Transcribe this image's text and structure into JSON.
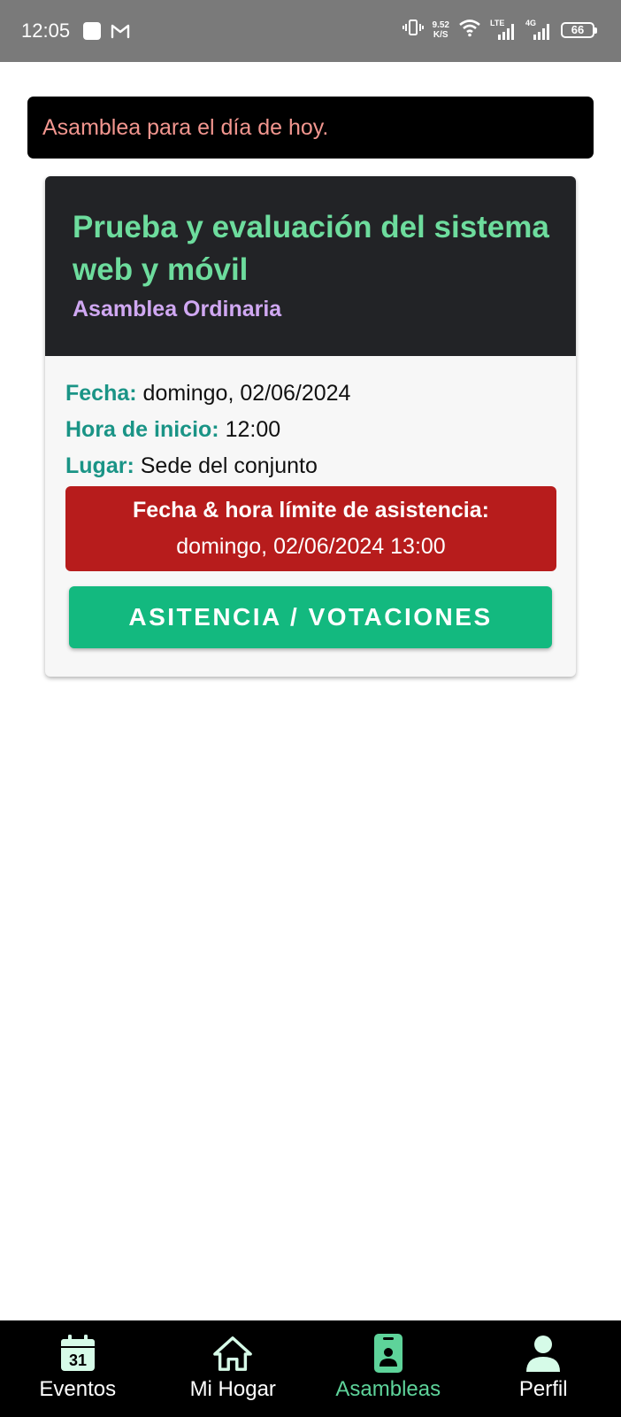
{
  "status_bar": {
    "time": "12:05",
    "net_speed_value": "9.52",
    "net_speed_unit": "K/S",
    "sim1_label": "LTE",
    "sim2_label": "4G",
    "battery": "66"
  },
  "banner": {
    "text": "Asamblea para el día de hoy."
  },
  "card": {
    "title": "Prueba y evaluación del sistema web y móvil",
    "subtitle": "Asamblea Ordinaria",
    "fecha_label": "Fecha:",
    "fecha_value": "domingo, 02/06/2024",
    "hora_label": "Hora de inicio:",
    "hora_value": "12:00",
    "lugar_label": "Lugar:",
    "lugar_value": "Sede del conjunto",
    "deadline_title": "Fecha & hora límite de asistencia:",
    "deadline_value": "domingo, 02/06/2024 13:00",
    "action_label": "ASITENCIA / VOTACIONES"
  },
  "nav": {
    "items": [
      {
        "label": "Eventos",
        "icon": "calendar-icon",
        "calendar_day": "31"
      },
      {
        "label": "Mi Hogar",
        "icon": "home-icon"
      },
      {
        "label": "Asambleas",
        "icon": "badge-icon"
      },
      {
        "label": "Perfil",
        "icon": "person-icon"
      }
    ],
    "active_index": 2
  },
  "colors": {
    "status_bar": "#7a7a7a",
    "banner_bg": "#000000",
    "banner_text": "#f2968f",
    "card_header": "#222326",
    "title": "#6ddc9d",
    "subtitle": "#d0a8f2",
    "label": "#1a9486",
    "deadline_bg": "#b71c1c",
    "action_bg": "#13b97f",
    "nav_bg": "#000000",
    "nav_icon": "#d6fbe8",
    "nav_active": "#5ed39a"
  }
}
